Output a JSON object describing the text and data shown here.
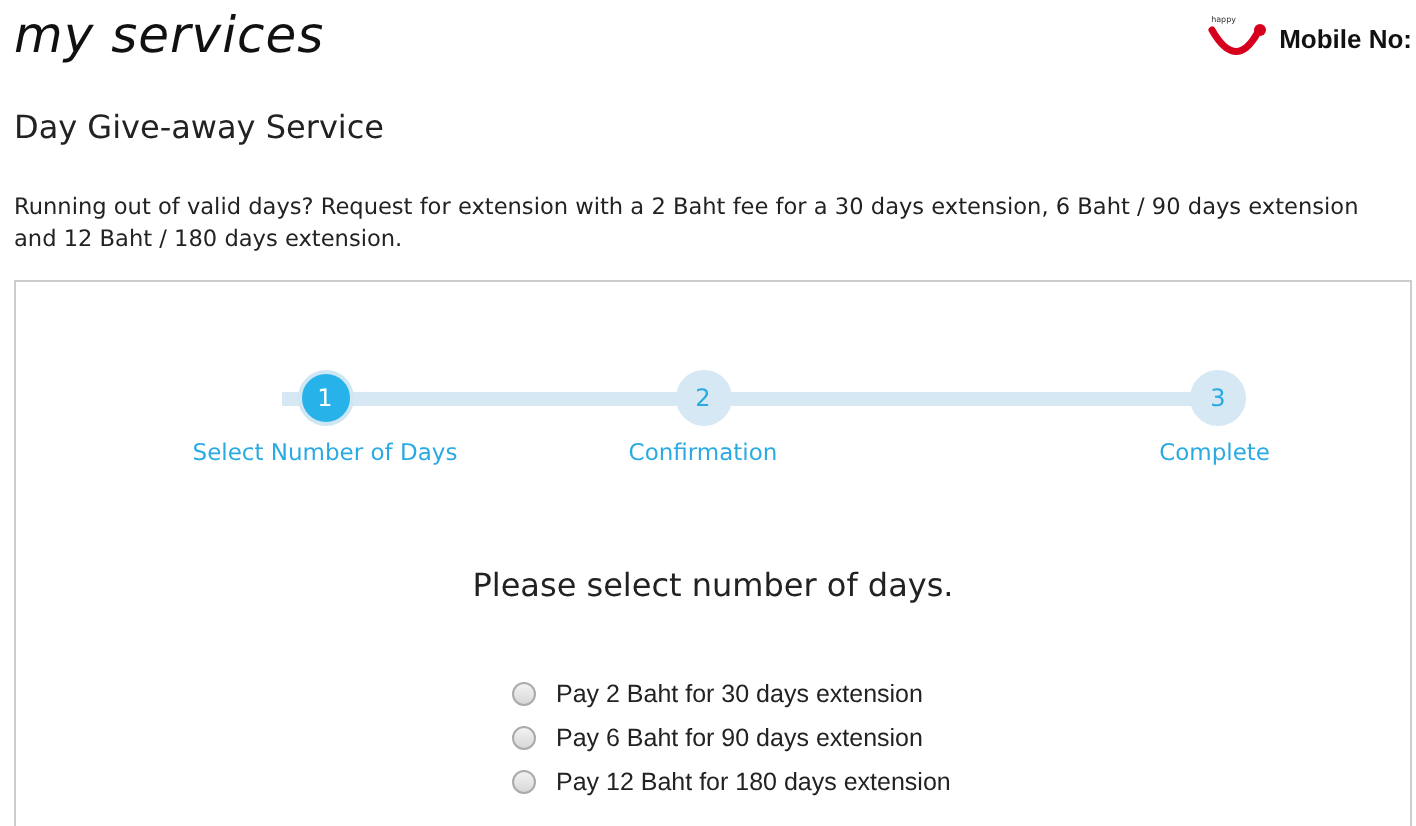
{
  "header": {
    "title": "my services",
    "logo_text": "happy",
    "mobile_label": "Mobile No:"
  },
  "page_title": "Day Give-away Service",
  "description": "Running out of valid days? Request for extension with a 2 Baht fee for a 30 days extension, 6 Baht / 90 days extension and 12 Baht / 180 days extension.",
  "steps": [
    {
      "number": "1",
      "label": "Select Number of Days",
      "selected": true
    },
    {
      "number": "2",
      "label": "Confirmation",
      "selected": false
    },
    {
      "number": "3",
      "label": "Complete",
      "selected": false
    }
  ],
  "prompt": "Please select number of days.",
  "options": [
    {
      "label": "Pay 2 Baht for 30 days extension",
      "selected": false
    },
    {
      "label": "Pay 6 Baht for 90 days extension",
      "selected": false
    },
    {
      "label": "Pay 12 Baht for 180 days extension",
      "selected": false
    }
  ]
}
